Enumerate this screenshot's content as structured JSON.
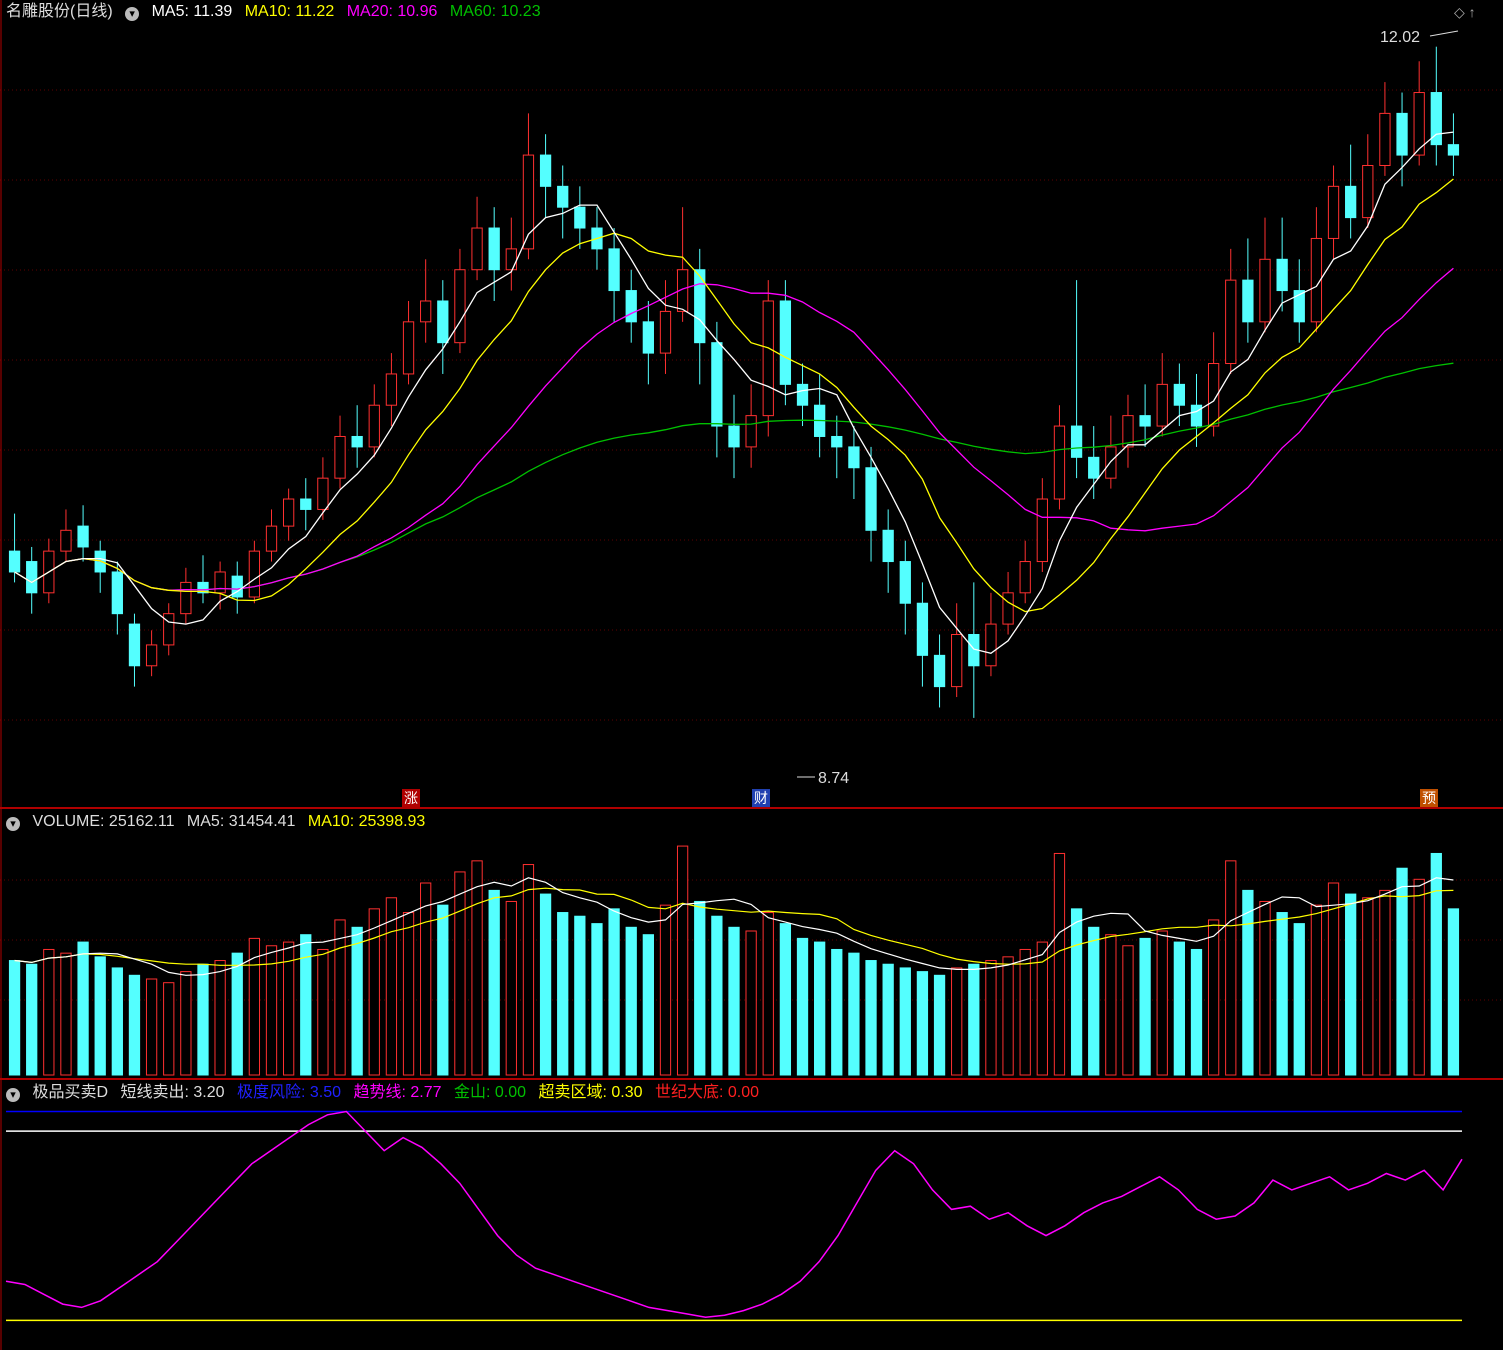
{
  "main_header": {
    "stock": "名雕股份",
    "period": "(日线)",
    "ma5": "MA5: 11.39",
    "ma10": "MA10: 11.22",
    "ma20": "MA20: 10.96",
    "ma60": "MA60: 10.23"
  },
  "volume_header": {
    "volume": "VOLUME: 25162.11",
    "ma5": "MA5: 31454.41",
    "ma10": "MA10: 25398.93"
  },
  "indicator_header": {
    "name": "极品买卖D",
    "short_sell": "短线卖出: 3.20",
    "extreme_risk": "极度风险: 3.50",
    "trend_line": "趋势线: 2.77",
    "golden_mountain": "金山: 0.00",
    "oversold_zone": "超卖区域: 0.30",
    "century_bottom": "世纪大底: 0.00"
  },
  "annotations": {
    "high_price": "12.02",
    "low_price": "8.74"
  },
  "markers": {
    "zhang": "涨",
    "cai": "财",
    "yu": "预"
  },
  "colors": {
    "up": "#ff3030",
    "down": "#54ffff",
    "ma5": "#ffffff",
    "ma10": "#ffff00",
    "ma20": "#ff00ff",
    "ma60": "#00c000",
    "extreme_risk": "#0000ff",
    "trend_line": "#ff00ff",
    "oversold": "#ffff00",
    "century_bottom": "#ff0000",
    "separator": "#b00000"
  },
  "chart_data": {
    "type": "candlestick",
    "price_range": [
      8.74,
      12.02
    ],
    "candles": [
      [
        9.6,
        9.5,
        9.78,
        9.45
      ],
      [
        9.55,
        9.4,
        9.62,
        9.3
      ],
      [
        9.4,
        9.6,
        9.66,
        9.35
      ],
      [
        9.6,
        9.7,
        9.8,
        9.55
      ],
      [
        9.72,
        9.62,
        9.82,
        9.55
      ],
      [
        9.6,
        9.5,
        9.65,
        9.4
      ],
      [
        9.5,
        9.3,
        9.55,
        9.2
      ],
      [
        9.25,
        9.05,
        9.3,
        8.95
      ],
      [
        9.05,
        9.15,
        9.22,
        9.0
      ],
      [
        9.15,
        9.3,
        9.35,
        9.1
      ],
      [
        9.3,
        9.45,
        9.52,
        9.25
      ],
      [
        9.45,
        9.4,
        9.58,
        9.35
      ],
      [
        9.4,
        9.5,
        9.55,
        9.32
      ],
      [
        9.48,
        9.38,
        9.55,
        9.3
      ],
      [
        9.38,
        9.6,
        9.65,
        9.35
      ],
      [
        9.6,
        9.72,
        9.8,
        9.55
      ],
      [
        9.72,
        9.85,
        9.9,
        9.65
      ],
      [
        9.85,
        9.8,
        9.95,
        9.7
      ],
      [
        9.8,
        9.95,
        10.05,
        9.75
      ],
      [
        9.95,
        10.15,
        10.25,
        9.9
      ],
      [
        10.15,
        10.1,
        10.3,
        10.0
      ],
      [
        10.1,
        10.3,
        10.4,
        10.05
      ],
      [
        10.3,
        10.45,
        10.55,
        10.2
      ],
      [
        10.45,
        10.7,
        10.8,
        10.4
      ],
      [
        10.7,
        10.8,
        11.0,
        10.6
      ],
      [
        10.8,
        10.6,
        10.9,
        10.45
      ],
      [
        10.6,
        10.95,
        11.05,
        10.55
      ],
      [
        10.95,
        11.15,
        11.3,
        10.9
      ],
      [
        11.15,
        10.95,
        11.25,
        10.8
      ],
      [
        10.95,
        11.05,
        11.2,
        10.85
      ],
      [
        11.05,
        11.5,
        11.7,
        11.0
      ],
      [
        11.5,
        11.35,
        11.6,
        11.2
      ],
      [
        11.35,
        11.25,
        11.45,
        11.1
      ],
      [
        11.25,
        11.15,
        11.35,
        11.05
      ],
      [
        11.15,
        11.05,
        11.25,
        10.95
      ],
      [
        11.05,
        10.85,
        11.15,
        10.7
      ],
      [
        10.85,
        10.7,
        10.95,
        10.6
      ],
      [
        10.7,
        10.55,
        10.8,
        10.4
      ],
      [
        10.55,
        10.75,
        10.9,
        10.45
      ],
      [
        10.75,
        10.95,
        11.25,
        10.7
      ],
      [
        10.95,
        10.6,
        11.05,
        10.4
      ],
      [
        10.6,
        10.2,
        10.7,
        10.05
      ],
      [
        10.2,
        10.1,
        10.35,
        9.95
      ],
      [
        10.1,
        10.25,
        10.4,
        10.0
      ],
      [
        10.25,
        10.8,
        10.9,
        10.15
      ],
      [
        10.8,
        10.4,
        10.9,
        10.3
      ],
      [
        10.4,
        10.3,
        10.5,
        10.2
      ],
      [
        10.3,
        10.15,
        10.45,
        10.05
      ],
      [
        10.15,
        10.1,
        10.25,
        9.95
      ],
      [
        10.1,
        10.0,
        10.2,
        9.85
      ],
      [
        10.0,
        9.7,
        10.1,
        9.55
      ],
      [
        9.7,
        9.55,
        9.8,
        9.4
      ],
      [
        9.55,
        9.35,
        9.65,
        9.2
      ],
      [
        9.35,
        9.1,
        9.45,
        8.95
      ],
      [
        9.1,
        8.95,
        9.2,
        8.85
      ],
      [
        8.95,
        9.2,
        9.35,
        8.9
      ],
      [
        9.2,
        9.05,
        9.45,
        8.8
      ],
      [
        9.05,
        9.25,
        9.4,
        9.0
      ],
      [
        9.25,
        9.4,
        9.5,
        9.2
      ],
      [
        9.4,
        9.55,
        9.65,
        9.35
      ],
      [
        9.55,
        9.85,
        9.95,
        9.5
      ],
      [
        9.85,
        10.2,
        10.3,
        9.8
      ],
      [
        10.2,
        10.05,
        10.9,
        9.95
      ],
      [
        10.05,
        9.95,
        10.2,
        9.85
      ],
      [
        9.95,
        10.1,
        10.25,
        9.9
      ],
      [
        10.1,
        10.25,
        10.35,
        10.0
      ],
      [
        10.25,
        10.2,
        10.4,
        10.1
      ],
      [
        10.2,
        10.4,
        10.55,
        10.15
      ],
      [
        10.4,
        10.3,
        10.5,
        10.2
      ],
      [
        10.3,
        10.2,
        10.45,
        10.1
      ],
      [
        10.2,
        10.5,
        10.65,
        10.15
      ],
      [
        10.5,
        10.9,
        11.05,
        10.45
      ],
      [
        10.9,
        10.7,
        11.1,
        10.6
      ],
      [
        10.7,
        11.0,
        11.2,
        10.65
      ],
      [
        11.0,
        10.85,
        11.2,
        10.75
      ],
      [
        10.85,
        10.7,
        11.0,
        10.6
      ],
      [
        10.7,
        11.1,
        11.25,
        10.65
      ],
      [
        11.1,
        11.35,
        11.45,
        11.0
      ],
      [
        11.35,
        11.2,
        11.55,
        11.1
      ],
      [
        11.2,
        11.45,
        11.6,
        11.15
      ],
      [
        11.45,
        11.7,
        11.85,
        11.4
      ],
      [
        11.7,
        11.5,
        11.8,
        11.35
      ],
      [
        11.5,
        11.8,
        11.95,
        11.45
      ],
      [
        11.8,
        11.55,
        12.02,
        11.45
      ],
      [
        11.55,
        11.5,
        11.7,
        11.4
      ]
    ],
    "volume": [
      31000,
      30000,
      34000,
      33000,
      36000,
      32000,
      29000,
      27000,
      26000,
      25000,
      28000,
      30000,
      31000,
      33000,
      37000,
      35000,
      36000,
      38000,
      34000,
      42000,
      40000,
      45000,
      48000,
      44000,
      52000,
      46000,
      55000,
      58000,
      50000,
      47000,
      57000,
      49000,
      44000,
      43000,
      41000,
      45000,
      40000,
      38000,
      46000,
      62000,
      47000,
      43000,
      40000,
      39000,
      44000,
      41000,
      37000,
      36000,
      34000,
      33000,
      31000,
      30000,
      29000,
      28000,
      27000,
      29000,
      30000,
      31000,
      32000,
      34000,
      36000,
      60000,
      45000,
      40000,
      38000,
      35000,
      37000,
      39000,
      36000,
      34000,
      42000,
      58000,
      50000,
      47000,
      44000,
      41000,
      46000,
      52000,
      49000,
      48000,
      50000,
      56000,
      53000,
      60000,
      45000
    ],
    "indicator": {
      "series": [
        {
          "name": "趋势线",
          "values": [
            0.9,
            0.85,
            0.7,
            0.55,
            0.5,
            0.6,
            0.8,
            1.0,
            1.2,
            1.5,
            1.8,
            2.1,
            2.4,
            2.7,
            2.9,
            3.1,
            3.3,
            3.45,
            3.5,
            3.2,
            2.9,
            3.1,
            2.95,
            2.7,
            2.4,
            2.0,
            1.6,
            1.3,
            1.1,
            1.0,
            0.9,
            0.8,
            0.7,
            0.6,
            0.5,
            0.45,
            0.4,
            0.35,
            0.38,
            0.45,
            0.55,
            0.7,
            0.9,
            1.2,
            1.6,
            2.1,
            2.6,
            2.9,
            2.7,
            2.3,
            2.0,
            2.05,
            1.85,
            1.95,
            1.75,
            1.6,
            1.75,
            1.95,
            2.1,
            2.2,
            2.35,
            2.5,
            2.3,
            2.0,
            1.85,
            1.9,
            2.1,
            2.45,
            2.3,
            2.4,
            2.5,
            2.3,
            2.4,
            2.55,
            2.45,
            2.6,
            2.3,
            2.77
          ]
        }
      ],
      "levels": {
        "extreme_risk": 3.5,
        "short_sell": 3.2,
        "oversold": 0.3,
        "century_bottom": 0.0
      }
    }
  }
}
